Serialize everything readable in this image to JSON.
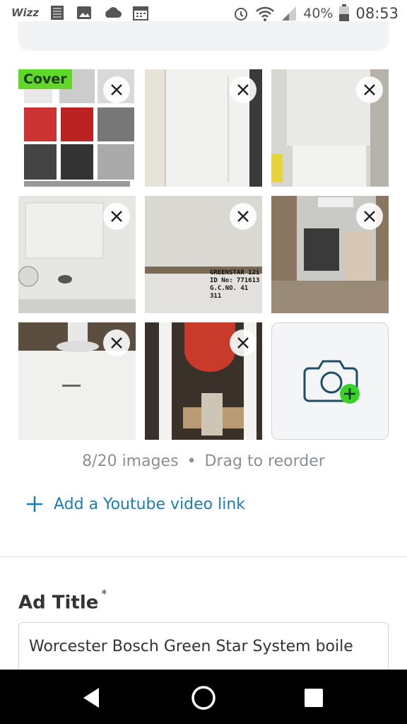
{
  "statusbar": {
    "carrier": "Wizz",
    "battery_percent": "40%",
    "time": "08:53"
  },
  "photos": {
    "cover_label": "Cover",
    "tiles": [
      {
        "name": "photo-collage",
        "close_icon": "close-icon"
      },
      {
        "name": "photo-boiler-front",
        "close_icon": "close-icon"
      },
      {
        "name": "photo-boiler-installed",
        "close_icon": "close-icon"
      },
      {
        "name": "photo-boiler-controls",
        "close_icon": "close-icon"
      },
      {
        "name": "photo-boiler-label",
        "close_icon": "close-icon"
      },
      {
        "name": "photo-boiler-internals",
        "close_icon": "close-icon"
      },
      {
        "name": "photo-boiler-top",
        "close_icon": "close-icon"
      },
      {
        "name": "photo-boiler-expansion-vessel",
        "close_icon": "close-icon"
      }
    ],
    "label_text_1": "GREENSTAR 12i",
    "label_text_2": "ID No:   771613",
    "label_text_3": "G.C.NO.  41 311",
    "add_photo_icon": "camera-plus-icon"
  },
  "counter": {
    "images": "8/20 images",
    "hint": "Drag to reorder"
  },
  "youtube_link": {
    "label": "Add a Youtube video link",
    "icon": "plus-icon"
  },
  "ad_title": {
    "label": "Ad Title",
    "required_mark": "*",
    "value": "Worcester Bosch Green Star System boile"
  },
  "colors": {
    "accent": "#1a7fb0",
    "cover_badge": "#5fd82a",
    "add_badge": "#3ad12a"
  }
}
